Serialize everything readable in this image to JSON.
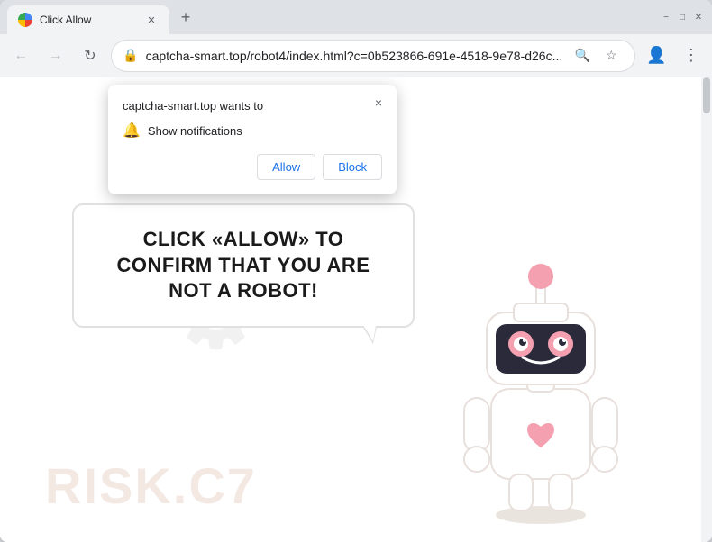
{
  "browser": {
    "tab": {
      "title": "Click Allow",
      "favicon": "globe"
    },
    "window_controls": {
      "minimize": "−",
      "maximize": "□",
      "close": "✕"
    },
    "toolbar": {
      "back": "←",
      "forward": "→",
      "refresh": "↻",
      "address": "captcha-smart.top/robot4/index.html?c=0b523866-691e-4518-9e78-d26c...",
      "search_icon": "🔍",
      "bookmark_icon": "☆",
      "profile_icon": "👤",
      "menu_icon": "⋮"
    }
  },
  "notification_popup": {
    "site": "captcha-smart.top wants to",
    "permission": "Show notifications",
    "allow_label": "Allow",
    "block_label": "Block",
    "close_icon": "×"
  },
  "page": {
    "bubble_text": "CLICK «ALLOW» TO CONFIRM THAT YOU ARE NOT A ROBOT!",
    "watermark_text": "⚙",
    "risk_watermark": "RISK.C7"
  }
}
